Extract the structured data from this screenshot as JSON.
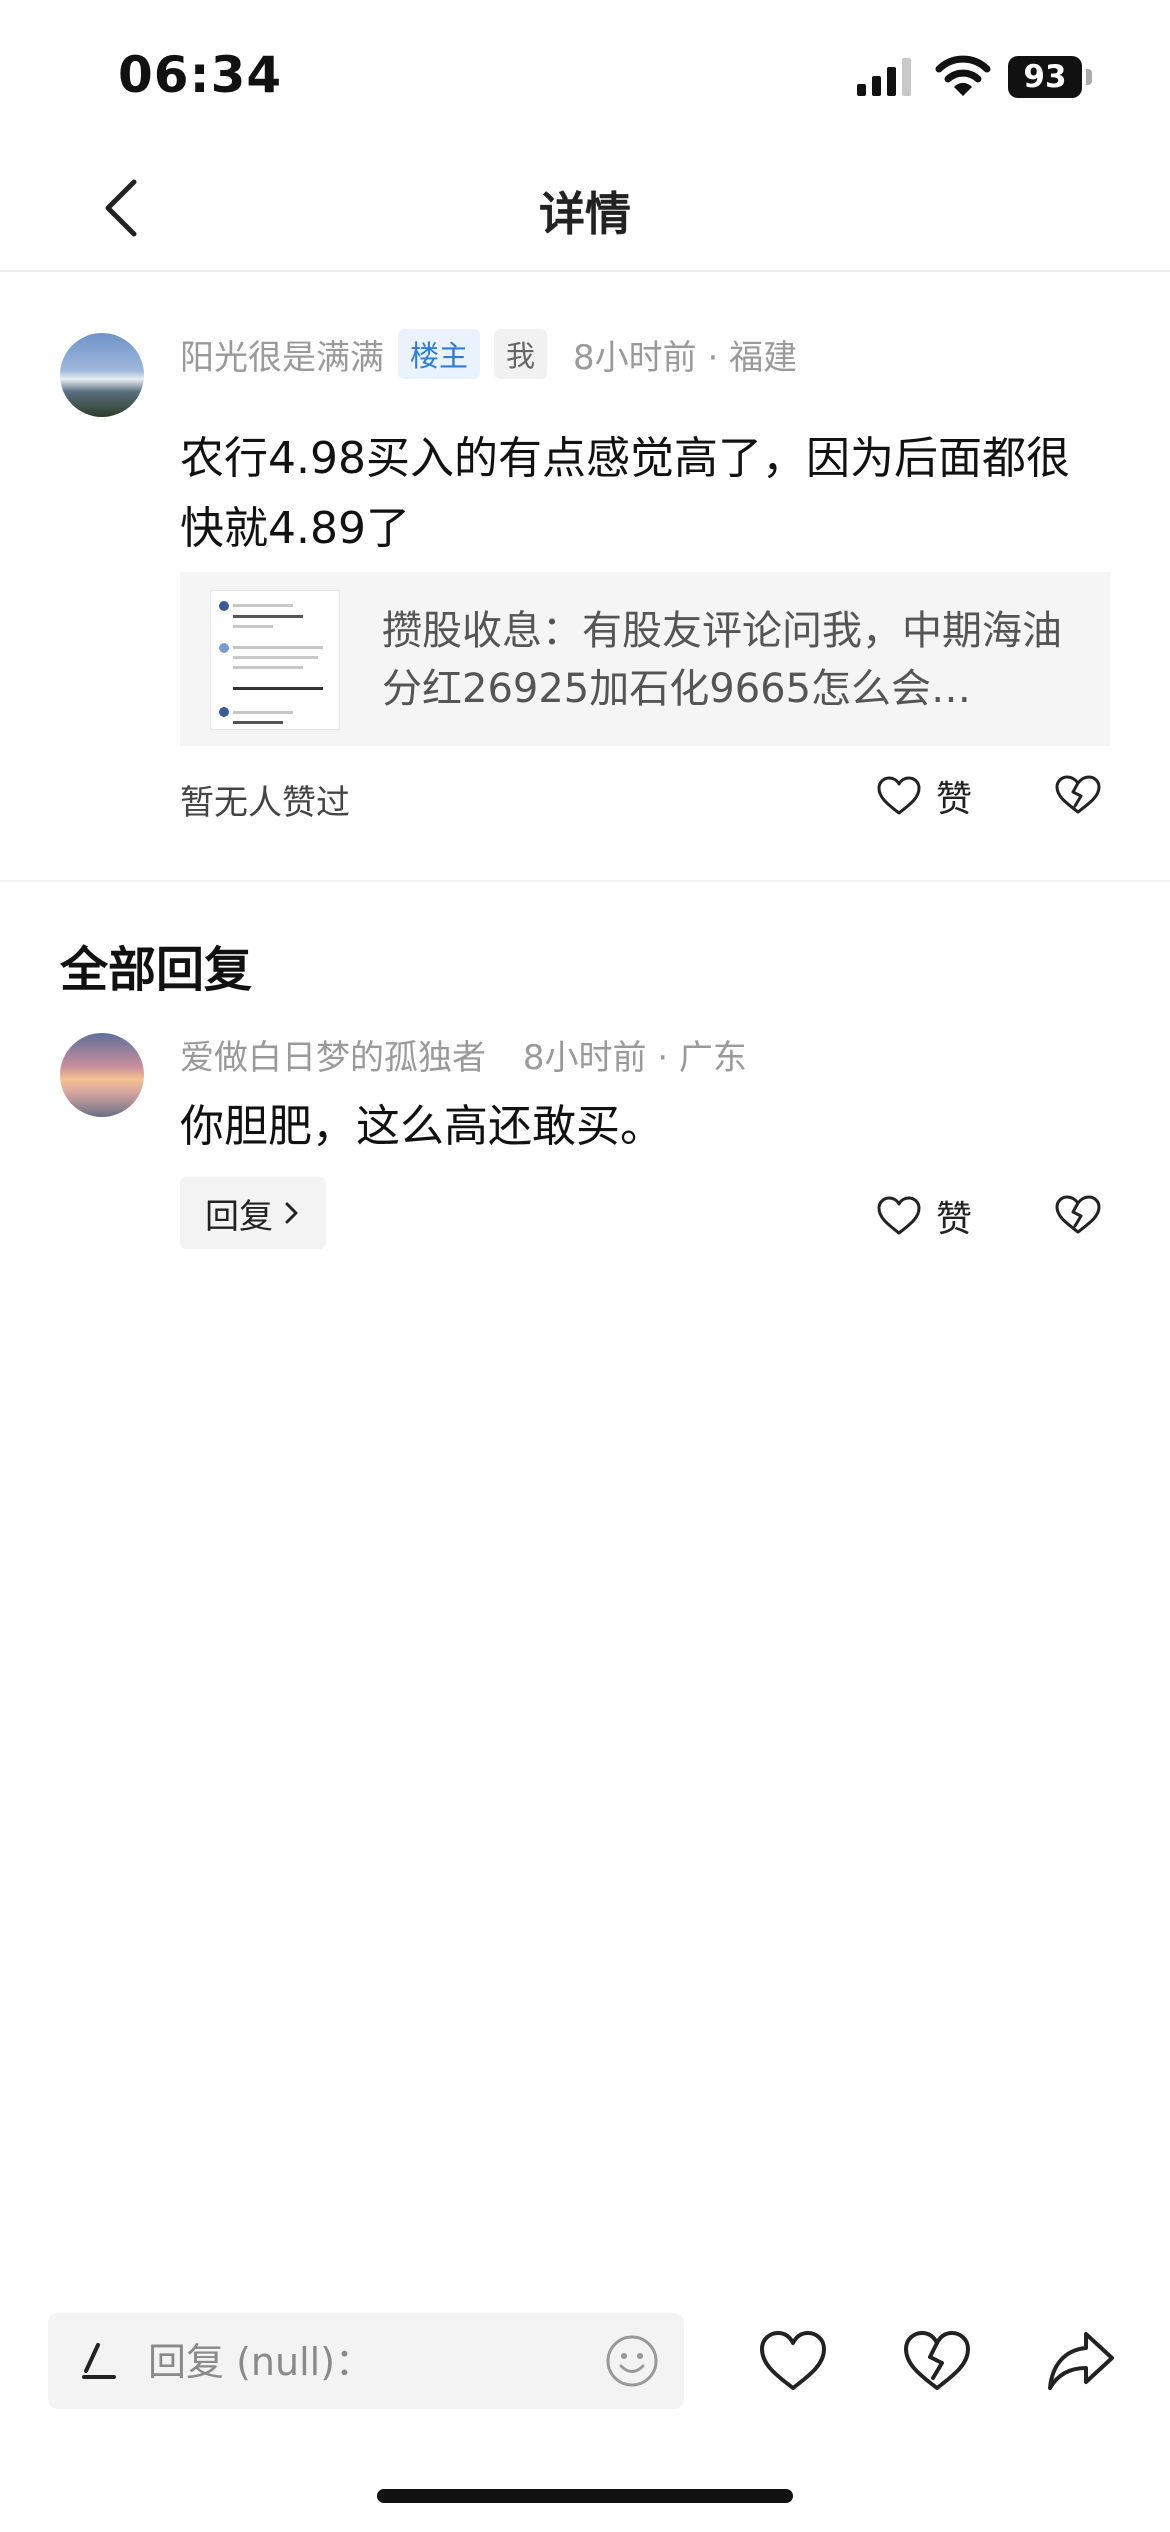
{
  "status_bar": {
    "time": "06:34",
    "battery": "93"
  },
  "nav": {
    "title": "详情"
  },
  "post": {
    "author": "阳光很是满满",
    "badges": {
      "owner": "楼主",
      "me": "我"
    },
    "time_location": "8小时前 · 福建",
    "content": "农行4.98买入的有点感觉高了，因为后面都很快就4.89了",
    "quote": "攒股收息：有股友评论问我，中期海油分红26925加石化9665怎么会…",
    "likes_status": "暂无人赞过",
    "like_label": "赞"
  },
  "replies_section": {
    "title": "全部回复"
  },
  "replies": [
    {
      "author": "爱做白日梦的孤独者",
      "time_location": "8小时前 · 广东",
      "content": "你胆肥，这么高还敢买。",
      "reply_label": "回复",
      "like_label": "赞"
    }
  ],
  "bottom_bar": {
    "input_placeholder": "回复 (null)："
  },
  "icons": {
    "back": "chevron-left-icon",
    "like": "heart-outline-icon",
    "dislike": "broken-heart-icon",
    "share": "share-arrow-icon",
    "emoji": "smiley-icon",
    "pen": "pen-icon"
  },
  "colors": {
    "owner_badge_text": "#2f7bd6",
    "owner_badge_bg": "#eaf3fd"
  }
}
